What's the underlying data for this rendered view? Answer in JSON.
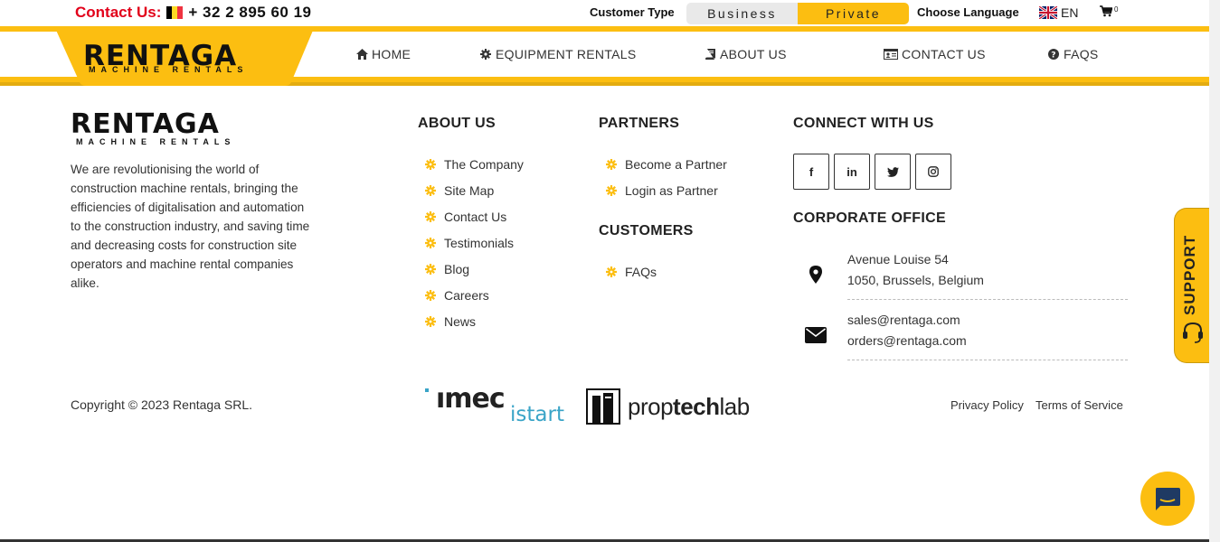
{
  "topbar": {
    "contact_label": "Contact Us:",
    "phone": "+ 32 2 895 60 19",
    "customer_type_label": "Customer Type",
    "customer_type_options": [
      "Business",
      "Private"
    ],
    "customer_type_selected": "Private",
    "language_label": "Choose Language",
    "language": "EN",
    "cart_count": "0"
  },
  "brand": {
    "name": "RENTAGA",
    "tagline": "MACHINE RENTALS"
  },
  "nav": {
    "items": [
      {
        "label": "HOME",
        "icon": "home-icon"
      },
      {
        "label": "EQUIPMENT RENTALS",
        "icon": "gear-icon"
      },
      {
        "label": "ABOUT US",
        "icon": "book-icon"
      },
      {
        "label": "CONTACT US",
        "icon": "id-card-icon"
      },
      {
        "label": "FAQS",
        "icon": "question-circle-icon"
      }
    ]
  },
  "footer": {
    "about_text": "We are revolutionising the world of construction machine rentals, bringing the efficiencies of digitalisation and automation to the construction industry, and saving time and decreasing costs for construction site operators and machine rental companies alike.",
    "about_us": {
      "title": "ABOUT US",
      "links": [
        "The Company",
        "Site Map",
        "Contact Us",
        "Testimonials",
        "Blog",
        "Careers",
        "News"
      ]
    },
    "partners": {
      "title": "PARTNERS",
      "links": [
        "Become a Partner",
        "Login as Partner"
      ]
    },
    "customers": {
      "title": "CUSTOMERS",
      "links": [
        "FAQs"
      ]
    },
    "connect": {
      "title": "CONNECT WITH US",
      "social": [
        {
          "name": "facebook",
          "glyph": "f"
        },
        {
          "name": "linkedin",
          "glyph": "in"
        },
        {
          "name": "twitter",
          "glyph": "t"
        },
        {
          "name": "instagram",
          "glyph": "◎"
        }
      ]
    },
    "office": {
      "title": "CORPORATE OFFICE",
      "address_line1": "Avenue Louise 54",
      "address_line2": "1050, Brussels, Belgium",
      "email1": "sales@rentaga.com",
      "email2": "orders@rentaga.com"
    },
    "copyright": "Copyright © 2023 Rentaga SRL.",
    "partner_logos": {
      "imec_word": "ımec",
      "imec_sub": "istart",
      "proptech_light": "prop",
      "proptech_bold": "tech",
      "proptech_end": "lab"
    },
    "legal": {
      "privacy": "Privacy Policy",
      "terms": "Terms of Service"
    }
  },
  "support_tab": {
    "label": "SUPPORT"
  },
  "colors": {
    "accent": "#fcbe11",
    "contact_red": "#e2001a",
    "text": "#333333"
  }
}
